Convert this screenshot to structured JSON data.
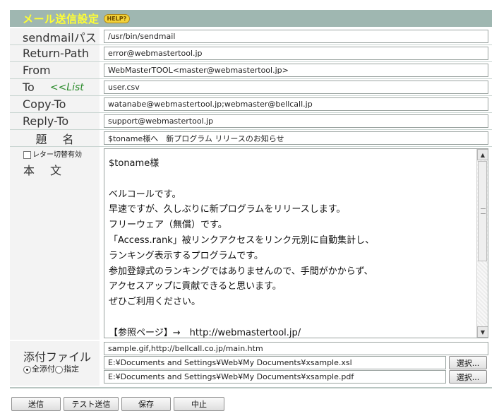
{
  "header": {
    "title": "メール送信設定",
    "help": "HELP?"
  },
  "fields": {
    "sendmail": {
      "label": "sendmailパス",
      "value": "/usr/bin/sendmail"
    },
    "return_path": {
      "label": "Return-Path",
      "value": "error@webmastertool.jp"
    },
    "from": {
      "label": "From",
      "value": "WebMasterTOOL<master@webmastertool.jp>"
    },
    "to": {
      "label": "To",
      "list_link": "<<List",
      "value": "user.csv"
    },
    "copy_to": {
      "label": "Copy-To",
      "value": "watanabe@webmastertool.jp;webmaster@bellcall.jp"
    },
    "reply_to": {
      "label": "Reply-To",
      "value": "support@webmastertool.jp"
    },
    "subject": {
      "label": "題名",
      "value": "$toname様へ　新プログラム リリースのお知らせ"
    }
  },
  "body": {
    "letter_toggle_label": "レター切替有効",
    "label": "本文",
    "text": "$toname様\n\nベルコールです。\n早速ですが、久しぶりに新プログラムをリリースします。\nフリーウェア（無償）です。\n「Access.rank」被リンクアクセスをリンク元別に自動集計し、\nランキング表示するプログラムです。\n参加登録式のランキングではありませんので、手間がかからず、\nアクセスアップに貢献できると思います。\nぜひご利用ください。\n\n【参照ページ】→　http://webmastertool.jp/"
  },
  "attachments": {
    "label": "添付ファイル",
    "radio_all": "全添付",
    "radio_specify": "指定",
    "selected_mode": "全添付",
    "list_value": "sample.gif,http://bellcall.co.jp/main.htm",
    "file1": "E:¥Documents and Settings¥Web¥My Documents¥xsample.xsl",
    "file2": "E:¥Documents and Settings¥Web¥My Documents¥xsample.pdf",
    "select_label": "選択..."
  },
  "actions": {
    "send": "送信",
    "test_send": "テスト送信",
    "save": "保存",
    "cancel": "中止"
  }
}
